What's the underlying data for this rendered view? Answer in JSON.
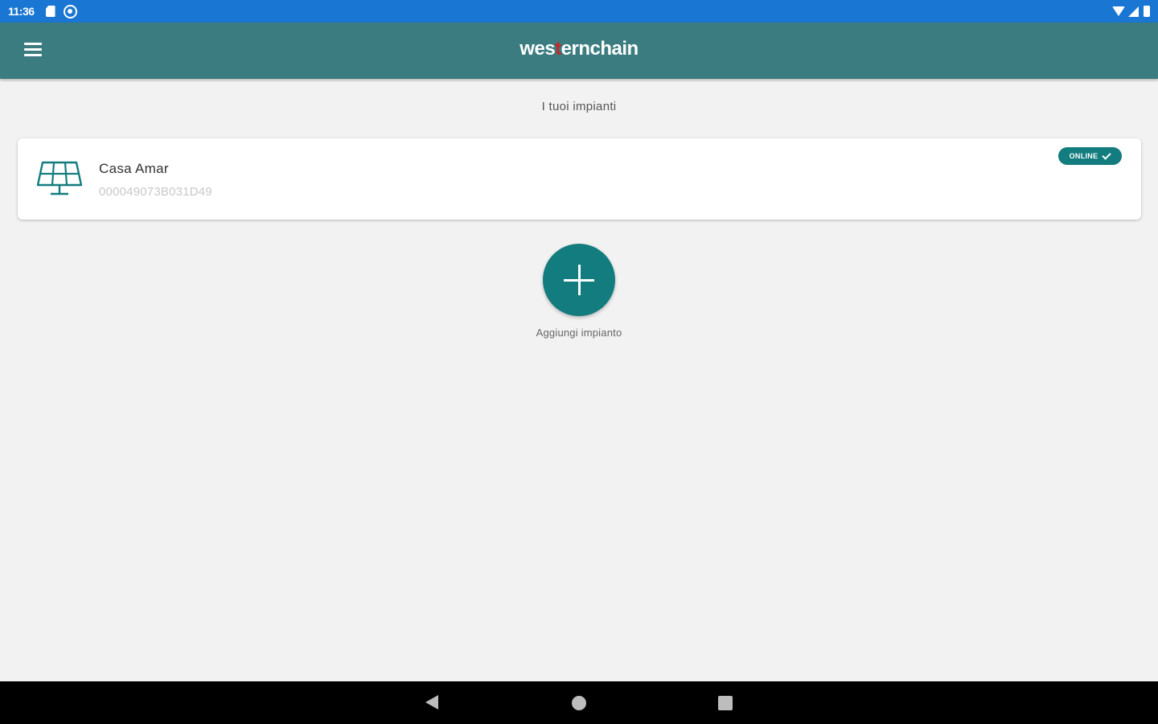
{
  "status_bar": {
    "time": "11:36",
    "icons": [
      "sd-card-icon",
      "sync-icon",
      "wifi-icon",
      "signal-icon",
      "battery-icon"
    ]
  },
  "app_bar": {
    "brand_left": "wes",
    "brand_mark": "t",
    "brand_right": "ernchain",
    "menu_icon": "hamburger-menu-icon",
    "background_color": "#3b7c80"
  },
  "main": {
    "section_title": "I tuoi impianti",
    "plants": [
      {
        "name": "Casa Amar",
        "serial": "000049073B031D49",
        "status": "ONLINE",
        "icon": "solar-panel-icon"
      }
    ],
    "add_button": {
      "label": "Aggiungi impianto",
      "icon": "plus-icon",
      "color": "#137c7e"
    }
  },
  "nav_bar": {
    "icons": [
      "back-icon",
      "home-icon",
      "recents-icon"
    ]
  }
}
